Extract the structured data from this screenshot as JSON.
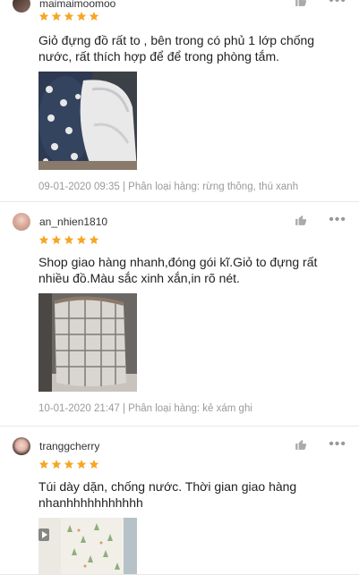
{
  "reviews": [
    {
      "username": "maimaimoomoo",
      "text": "Giỏ đựng đồ rất to , bên trong có phủ 1 lớp chống nước, rất thích hợp để để trong phòng tắm.",
      "meta": "09-01-2020 09:35 | Phân loại hàng: rừng thông, thú xanh",
      "rating": 5
    },
    {
      "username": "an_nhien1810",
      "text": "Shop giao hàng nhanh,đóng gói kĩ.Giỏ to đựng rất nhiều đồ.Màu sắc xinh xắn,in rõ nét.",
      "meta": "10-01-2020 21:47 | Phân loại hàng: kẻ xám ghi",
      "rating": 5
    },
    {
      "username": "tranggcherry",
      "text": "Túi dày dặn, chống nước. Thời gian giao hàng nhanhhhhhhhhhhh",
      "rating": 5
    }
  ],
  "icons": {
    "like": "thumbs-up-icon",
    "more": "more-icon",
    "star": "star-icon"
  },
  "colors": {
    "star": "#f6a623",
    "meta": "#9a9a9a"
  }
}
